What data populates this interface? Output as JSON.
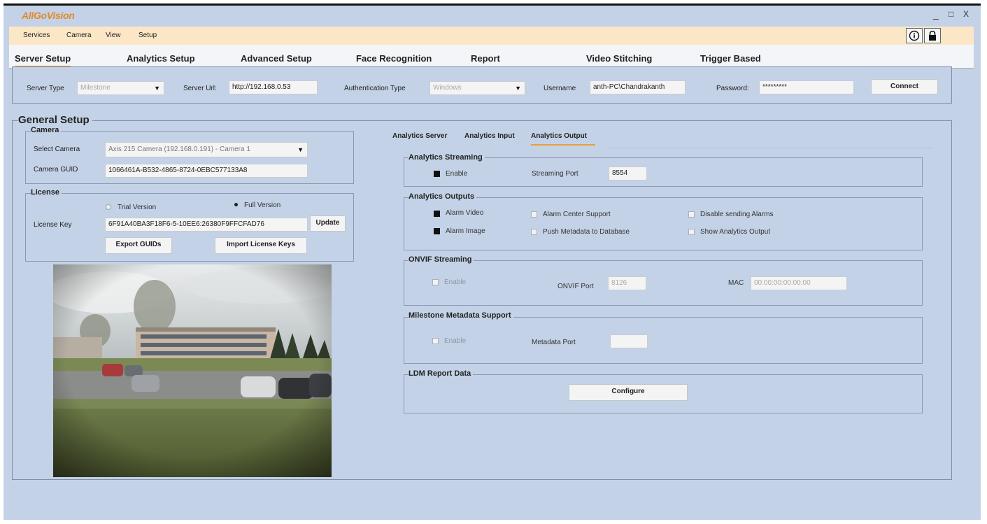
{
  "app": {
    "logo": "AllGoVision",
    "win_minimize": "_",
    "win_maximize": "□",
    "win_close": "X"
  },
  "menu": {
    "items": [
      "Services",
      "Camera",
      "View",
      "Setup"
    ],
    "info_icon": "info-icon",
    "lock_icon": "lock-icon"
  },
  "tabs": [
    "Server Setup",
    "Analytics Setup",
    "Advanced Setup",
    "Face Recognition",
    "Report",
    "Video Stitching",
    "Trigger Based"
  ],
  "active_tab": "Server Setup",
  "server": {
    "type_label": "Server Type",
    "type_value": "Milestone",
    "url_label": "Server Url:",
    "url_value": "http://192.168.0.53",
    "auth_label": "Authentication Type",
    "auth_value": "Windows",
    "username_label": "Username",
    "username_value": "anth-PC\\Chandrakanth",
    "password_label": "Password:",
    "password_value": "*********",
    "connect_label": "Connect"
  },
  "general": {
    "title": "General Setup",
    "camera": {
      "title": "Camera",
      "select_label": "Select Camera",
      "select_value": "Axis 215 Camera (192.168.0.191) - Camera 1",
      "guid_label": "Camera GUID",
      "guid_value": "1066461A-B532-4865-8724-0EBC577133A8"
    },
    "license": {
      "title": "License",
      "trial_label": "Trial Version",
      "full_label": "Full Version",
      "selected": "Full Version",
      "key_label": "License Key",
      "key_value": "6F91A40BA3F18F6-5-10EE6:26380F9FFCFAD76",
      "update_label": "Update",
      "export_label": "Export GUIDs",
      "import_label": "Import License Keys"
    }
  },
  "analytics_tabs": [
    "Analytics Server",
    "Analytics Input",
    "Analytics Output"
  ],
  "active_analytics_tab": "Analytics Output",
  "streaming": {
    "title": "Analytics Streaming",
    "enable_label": "Enable",
    "enable_checked": true,
    "port_label": "Streaming Port",
    "port_value": "8554"
  },
  "outputs": {
    "title": "Analytics Outputs",
    "items": [
      {
        "label": "Alarm Video",
        "checked": true
      },
      {
        "label": "Alarm Image",
        "checked": true
      },
      {
        "label": "Alarm Center Support",
        "checked": false
      },
      {
        "label": "Push Metadata to Database",
        "checked": false
      },
      {
        "label": "Disable sending Alarms",
        "checked": false
      },
      {
        "label": "Show Analytics Output",
        "checked": false
      }
    ]
  },
  "onvif": {
    "title": "ONVIF Streaming",
    "enable_label": "Enable",
    "port_label": "ONVIF Port",
    "port_value": "8126",
    "mac_label": "MAC",
    "mac_value": "00:00:00:00:00:00"
  },
  "milestone_meta": {
    "title": "Milestone Metadata Support",
    "enable_label": "Enable",
    "port_label": "Metadata Port",
    "port_value": ""
  },
  "ldm": {
    "title": "LDM Report Data",
    "configure_label": "Configure"
  },
  "colors": {
    "window_bg": "#c3d2e6",
    "menubar_bg": "#fbe6c6",
    "accent": "#e8a03a"
  }
}
